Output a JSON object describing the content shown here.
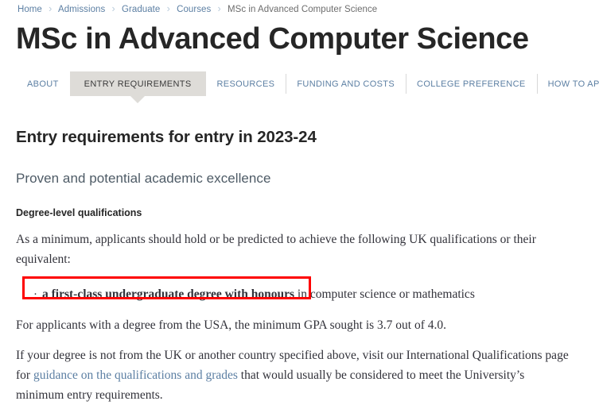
{
  "breadcrumb": {
    "separator": "›",
    "items": [
      {
        "label": "Home",
        "current": false
      },
      {
        "label": "Admissions",
        "current": false
      },
      {
        "label": "Graduate",
        "current": false
      },
      {
        "label": "Courses",
        "current": false
      },
      {
        "label": "MSc in Advanced Computer Science",
        "current": true
      }
    ]
  },
  "header": {
    "title": "MSc in Advanced Computer Science"
  },
  "tabs": [
    {
      "label": "ABOUT",
      "active": false
    },
    {
      "label": "ENTRY REQUIREMENTS",
      "active": true
    },
    {
      "label": "RESOURCES",
      "active": false
    },
    {
      "label": "FUNDING AND COSTS",
      "active": false
    },
    {
      "label": "COLLEGE PREFERENCE",
      "active": false
    },
    {
      "label": "HOW TO APPLY",
      "active": false
    }
  ],
  "main": {
    "heading": "Entry requirements for entry in 2023-24",
    "subheading": "Proven and potential academic excellence",
    "section_label": "Degree-level qualifications",
    "intro_paragraph": "As a minimum, applicants should hold or be predicted to achieve the following UK qualifications or their equivalent:",
    "requirement_bullet": {
      "marker": "·",
      "bold_text": "a first-class undergraduate degree with honours",
      "rest_text": " in computer science or mathematics"
    },
    "gpa_paragraph": "For applicants with a degree from the USA, the minimum GPA sought is 3.7 out of 4.0.",
    "international_paragraph": {
      "before_link": "If your degree is not from the UK or another country specified above, visit our International Qualifications page for ",
      "link_text": "guidance on the qualifications and grades",
      "after_link": " that would usually be considered to meet the University’s minimum entry requirements."
    }
  },
  "annotation": {
    "color": "#fe0000",
    "label": "red-highlight-box"
  }
}
